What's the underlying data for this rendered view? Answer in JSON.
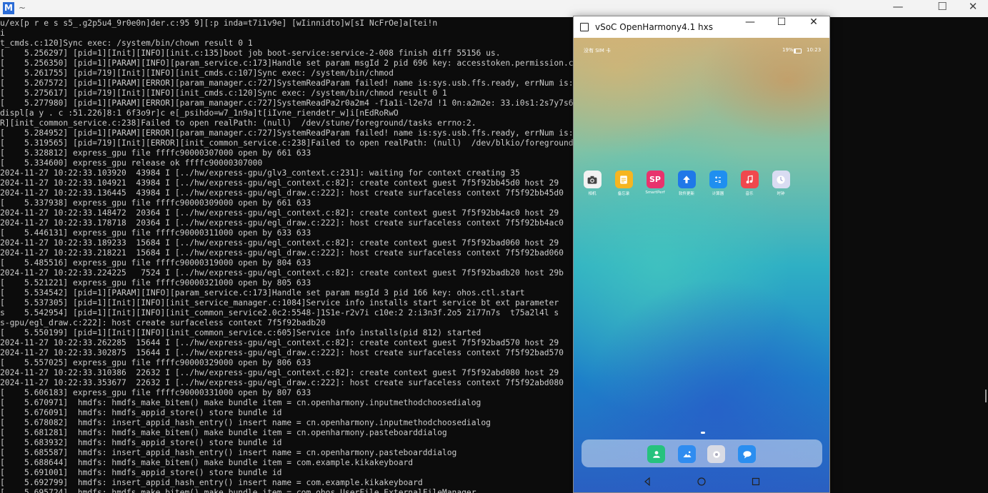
{
  "terminal": {
    "title": "~",
    "app_icon_letter": "M",
    "lines": [
      "u/ex[p r e s s5_.g2p5u4_9r0e0n]der.c:95 9][:p inda=t7i1v9e] [wIinnidto]w[sI NcFrOe]a[tei!n",
      "i",
      "t_cmds.c:120]Sync exec: /system/bin/chown result 0 1",
      "[    5.256297] [pid=1][Init][INFO][init.c:135]boot job boot-service:service-2-008 finish diff 55156 us.",
      "[    5.256350] [pid=1][PARAM][INFO][param_service.c:173]Handle set param msgId 2 pid 696 key: accesstoken.permission.change",
      "[    5.261755] [pid=719][Init][INFO][init_cmds.c:107]Sync exec: /system/bin/chmod",
      "[    5.267572] [pid=1][PARAM][ERROR][param_manager.c:727]SystemReadParam failed! name is:sys.usb.ffs.ready, errNum is:106!",
      "[    5.275617] [pid=719][Init][INFO][init_cmds.c:120]Sync exec: /system/bin/chmod result 0 1",
      "[    5.277980] [pid=1][PARAM][ERROR][param_manager.c:727]SystemReadPa2r0a2m4 -f1a1i-l2e7d !1 0n:a2m2e: 33.i0s1:2s7y7s6.4u2s b.iefgpsu:/1ex0pr6es!s",
      "displ[a y . c :51.226]8:1 6f3o9r]c e[_psihdo=w7_1n9a]t[iIvne_riendetr_w]i[nEdRoRwO",
      "R][init_common_service.c:238]Failed to open realPath: (null)  /dev/stune/foreground/tasks errno:2.",
      "[    5.284952] [pid=1][PARAM][ERROR][param_manager.c:727]SystemReadParam failed! name is:sys.usb.ffs.ready, errNum is:106!",
      "[    5.319565] [pid=719][Init][ERROR][init_common_service.c:238]Failed to open realPath: (null)  /dev/blkio/foreground/tasks errno:2.",
      "[    5.328812] express_gpu file ffffc90000307000 open by 661 633",
      "[    5.334600] express_gpu release ok ffffc90000307000",
      "2024-11-27 10:22:33.103920  43984 I [../hw/express-gpu/glv3_context.c:231]: waiting for context creating 35",
      "2024-11-27 10:22:33.104921  43984 I [../hw/express-gpu/egl_context.c:82]: create context guest 7f5f92bb45d0 host 29",
      "2024-11-27 10:22:33.136445  43984 I [../hw/express-gpu/egl_draw.c:222]: host create surfaceless context 7f5f92bb45d0",
      "[    5.337938] express_gpu file ffffc90000309000 open by 661 633",
      "2024-11-27 10:22:33.148472  20364 I [../hw/express-gpu/egl_context.c:82]: create context guest 7f5f92bb4ac0 host 29",
      "2024-11-27 10:22:33.178718  20364 I [../hw/express-gpu/egl_draw.c:222]: host create surfaceless context 7f5f92bb4ac0",
      "[    5.446131] express_gpu file ffffc90000311000 open by 633 633",
      "2024-11-27 10:22:33.189233  15684 I [../hw/express-gpu/egl_context.c:82]: create context guest 7f5f92bad060 host 29",
      "2024-11-27 10:22:33.218221  15684 I [../hw/express-gpu/egl_draw.c:222]: host create surfaceless context 7f5f92bad060",
      "[    5.485516] express_gpu file ffffc90000319000 open by 804 633",
      "2024-11-27 10:22:33.224225   7524 I [../hw/express-gpu/egl_context.c:82]: create context guest 7f5f92badb20 host 29b",
      "[    5.521221] express_gpu file ffffc90000321000 open by 805 633",
      "[    5.534542] [pid=1][PARAM][INFO][param_service.c:173]Handle set param msgId 3 pid 166 key: ohos.ctl.start",
      "[    5.537305] [pid=1][Init][INFO][init_service_manager.c:1084]Service info installs start service bt ext parameter",
      "s    5.542954] [pid=1][Init][INFO][init_common_service2.0c2:5548-]1S1e-r2v7i c10e:2 2:i3n3f.2o5 2i77n7s  t75a2l4l s",
      "s-gpu/egl_draw.c:222]: host create surfaceless context 7f5f92badb20",
      "[    5.550199] [pid=1][Init][INFO][init_common_service.c:605]Service info installs(pid 812) started",
      "2024-11-27 10:22:33.262285  15644 I [../hw/express-gpu/egl_context.c:82]: create context guest 7f5f92bad570 host 29",
      "2024-11-27 10:22:33.302875  15644 I [../hw/express-gpu/egl_draw.c:222]: host create surfaceless context 7f5f92bad570",
      "[    5.557025] express_gpu file ffffc90000329000 open by 806 633",
      "2024-11-27 10:22:33.310386  22632 I [../hw/express-gpu/egl_context.c:82]: create context guest 7f5f92abd080 host 29",
      "2024-11-27 10:22:33.353677  22632 I [../hw/express-gpu/egl_draw.c:222]: host create surfaceless context 7f5f92abd080",
      "[    5.606183] express_gpu file ffffc90000331000 open by 807 633",
      "[    5.670971]  hmdfs: hmdfs_make_bitem() make bundle item = cn.openharmony.inputmethodchoosedialog",
      "[    5.676091]  hmdfs: hmdfs_appid_store() store bundle id",
      "[    5.678082]  hmdfs: insert_appid_hash_entry() insert name = cn.openharmony.inputmethodchoosedialog",
      "[    5.681281]  hmdfs: hmdfs_make_bitem() make bundle item = cn.openharmony.pasteboarddialog",
      "[    5.683932]  hmdfs: hmdfs_appid_store() store bundle id",
      "[    5.685587]  hmdfs: insert_appid_hash_entry() insert name = cn.openharmony.pasteboarddialog",
      "[    5.688644]  hmdfs: hmdfs_make_bitem() make bundle item = com.example.kikakeyboard",
      "[    5.691001]  hmdfs: hmdfs_appid_store() store bundle id",
      "[    5.692799]  hmdfs: insert_appid_hash_entry() insert name = com.example.kikakeyboard",
      "[    5.695724]  hmdfs: hmdfs_make_bitem() make bundle item = com.ohos.UserFile.ExternalFileManager"
    ],
    "window_controls": {
      "minimize": "—",
      "maximize": "☐",
      "close": "✕"
    }
  },
  "emulator": {
    "title": "vSoC OpenHarmony4.1 hxs",
    "window_controls": {
      "minimize": "—",
      "maximize": "☐",
      "close": "✕"
    },
    "status_bar": {
      "carrier": "没有 SIM 卡",
      "battery": "19%",
      "time": "10:23"
    },
    "apps": [
      {
        "label": "相机",
        "icon": "camera-icon",
        "color": "#f2f2f2"
      },
      {
        "label": "备忘录",
        "icon": "notes-icon",
        "color": "#f6b520"
      },
      {
        "label": "SmartPerf",
        "icon": "smartperf-icon",
        "glyph": "SP",
        "color": "#e8336d"
      },
      {
        "label": "软件更新",
        "icon": "update-icon",
        "color": "#1f78e8"
      },
      {
        "label": "计算器",
        "icon": "calculator-icon",
        "color": "#1f8ff0"
      },
      {
        "label": "音乐",
        "icon": "music-icon",
        "color": "#f0484d"
      },
      {
        "label": "时钟",
        "icon": "clock-icon",
        "color": "#d9dcf2"
      }
    ],
    "dock_apps": [
      {
        "icon": "contacts-icon",
        "color": "#26c27e"
      },
      {
        "icon": "gallery-icon",
        "color": "#2f8cf0"
      },
      {
        "icon": "settings-icon",
        "color": "#d9dbe4"
      },
      {
        "icon": "messages-icon",
        "color": "#2a8ef0"
      }
    ],
    "nav": {
      "back": "back-icon",
      "home": "home-icon",
      "recents": "recents-icon"
    }
  }
}
